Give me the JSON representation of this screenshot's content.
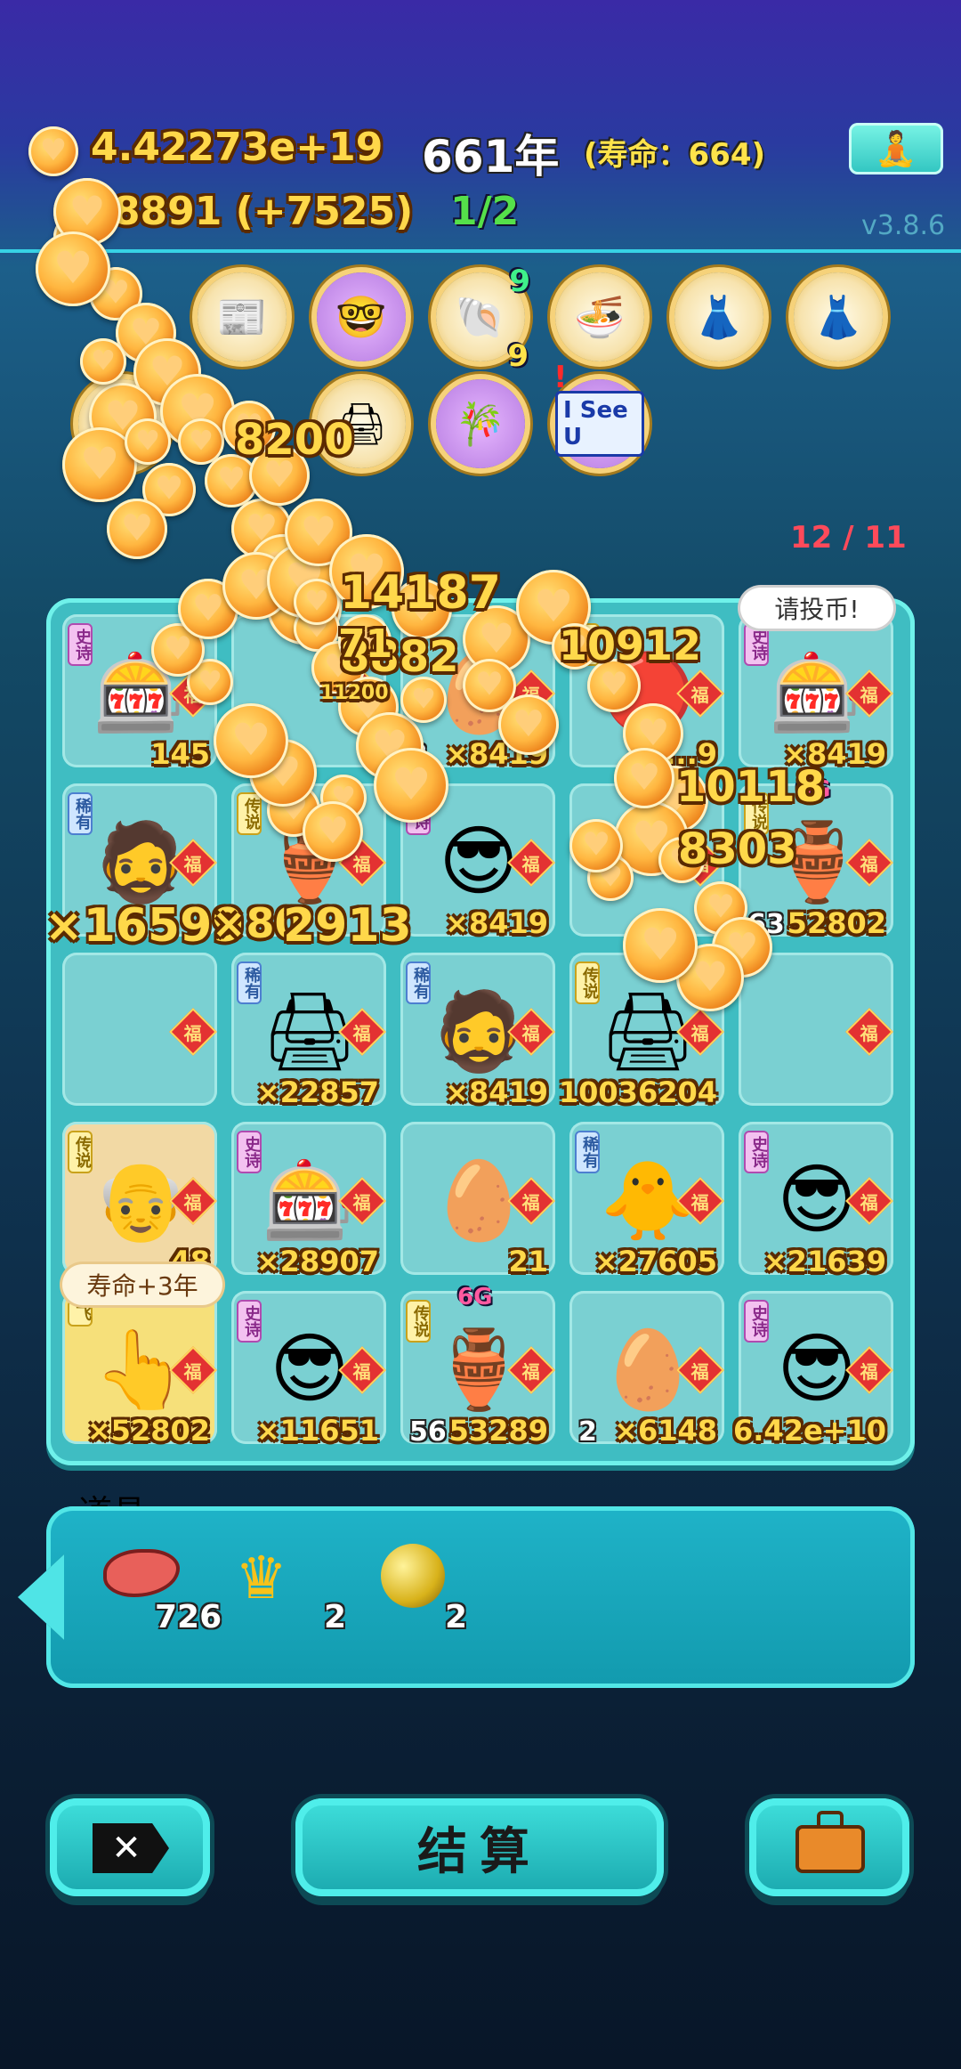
{
  "hud": {
    "coins": "4.42273e+19",
    "year": "661年",
    "lifespan": "(寿命：664)",
    "income": "+8891 (+7525)",
    "progress": "1/2",
    "version": "v3.8.6",
    "meditate_icon": "meditation-icon"
  },
  "top_icons": [
    {
      "icon": "time-newspaper-icon"
    },
    {
      "icon": "math-face-icon"
    },
    {
      "icon": "shell-icon",
      "badge_top": "9",
      "badge_bottom": "9"
    },
    {
      "icon": "bowls-icon"
    },
    {
      "icon": "skirt-icon"
    },
    {
      "icon": "skirt-icon"
    },
    {
      "icon": "book-icon"
    },
    {
      "icon": "printer-icon"
    },
    {
      "icon": "bamboo-ruler-icon"
    },
    {
      "icon": "i-see-u-sign-icon",
      "text": "I See U"
    }
  ],
  "floating_numbers": [
    "8200",
    "14187",
    "8882",
    "10912",
    "11200",
    "10118",
    "8303",
    "×16599",
    "×80",
    "2913",
    "71"
  ],
  "board": {
    "counter": "12 / 11",
    "speech": "请投币!",
    "life_bubble": "寿命+3年",
    "cells": [
      {
        "rarity": "史诗",
        "rclass": "epic",
        "art": "gacha-machine",
        "count": "145"
      },
      {
        "rarity": "",
        "rclass": "",
        "art": "blank",
        "count": ""
      },
      {
        "rarity": "",
        "rclass": "",
        "art": "egg",
        "level": "3",
        "count": "×8419"
      },
      {
        "rarity": "传说",
        "rclass": "leg",
        "art": "red-ball",
        "count": "×...9"
      },
      {
        "rarity": "史诗",
        "rclass": "epic",
        "art": "gacha-machine",
        "count": "×8419"
      },
      {
        "rarity": "稀有",
        "rclass": "rare",
        "art": "hat-man",
        "count": ""
      },
      {
        "rarity": "传说",
        "rclass": "leg",
        "art": "jade-vase",
        "count": ""
      },
      {
        "rarity": "史诗",
        "rclass": "epic",
        "art": "green-cap-man",
        "count": "×8419"
      },
      {
        "rarity": "",
        "rclass": "",
        "art": "blank",
        "count": ""
      },
      {
        "rarity": "传说",
        "rclass": "leg",
        "art": "jade-vase",
        "level": "63",
        "count": "52802",
        "tag": "6G"
      },
      {
        "rarity": "",
        "rclass": "",
        "art": "blank",
        "count": ""
      },
      {
        "rarity": "稀有",
        "rclass": "rare",
        "art": "blue-printer",
        "count": "×22857"
      },
      {
        "rarity": "稀有",
        "rclass": "rare",
        "art": "hat-man",
        "count": "×8419"
      },
      {
        "rarity": "传说",
        "rclass": "leg",
        "art": "yellow-printer",
        "count": "10036204"
      },
      {
        "rarity": "",
        "rclass": "",
        "art": "blank",
        "count": ""
      },
      {
        "rarity": "传说",
        "rclass": "leg",
        "art": "bald-man",
        "count": "...48"
      },
      {
        "rarity": "史诗",
        "rclass": "epic",
        "art": "gacha-machine",
        "count": "×28907"
      },
      {
        "rarity": "",
        "rclass": "",
        "art": "egg",
        "count": "21"
      },
      {
        "rarity": "稀有",
        "rclass": "rare",
        "art": "chick",
        "count": "×27605"
      },
      {
        "rarity": "史诗",
        "rclass": "epic",
        "art": "green-cap-man",
        "count": "×21639"
      },
      {
        "rarity": "飞",
        "rclass": "leg",
        "art": "plus-hand",
        "count": "×52802"
      },
      {
        "rarity": "史诗",
        "rclass": "epic",
        "art": "green-cap-man",
        "count": "×11651"
      },
      {
        "rarity": "传说",
        "rclass": "leg",
        "art": "jade-vase",
        "level": "56",
        "count": "53289",
        "tag": "6G"
      },
      {
        "rarity": "",
        "rclass": "",
        "art": "egg",
        "level": "2",
        "count": "×6148"
      },
      {
        "rarity": "史诗",
        "rclass": "epic",
        "art": "green-cap-man",
        "count": "6.42e+10"
      }
    ],
    "fu_label": "福"
  },
  "items": {
    "title": "道具",
    "list": [
      {
        "icon": "liver-icon",
        "count": "726"
      },
      {
        "icon": "crown-icon",
        "count": "2"
      },
      {
        "icon": "gold-ball-icon",
        "count": "2"
      }
    ]
  },
  "buttons": {
    "close_icon": "close-icon",
    "settle": "结算",
    "bag_icon": "briefcase-icon"
  },
  "colors": {
    "accent": "#3fbdc2",
    "coin_gold": "#ffd84a",
    "counter_red": "#ff4a5a",
    "progress_green": "#55e04a"
  }
}
